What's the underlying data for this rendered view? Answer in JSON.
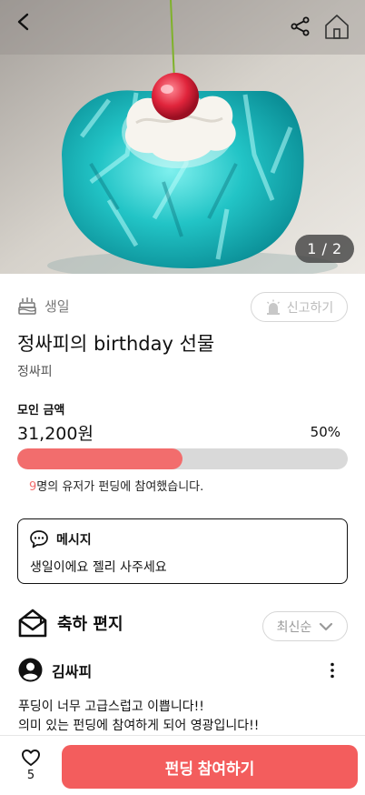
{
  "hero": {
    "page_indicator": "1 / 2",
    "icons": {
      "back": "back-arrow-icon",
      "share": "share-icon",
      "home": "home-icon"
    }
  },
  "category": {
    "icon": "birthday-cake-icon",
    "label": "생일"
  },
  "report_button": {
    "icon": "siren-icon",
    "label": "신고하기"
  },
  "title": "정싸피의 birthday 선물",
  "author": "정싸피",
  "funding": {
    "label": "모인 금액",
    "amount": "31,200원",
    "percent_text": "50%",
    "progress": 0.5,
    "participant_count": "9",
    "participant_suffix": "명의 유저가 펀딩에 참여했습니다."
  },
  "message": {
    "icon": "speech-bubble-icon",
    "title": "메시지",
    "body": "생일이에요 젤리 사주세요"
  },
  "letters": {
    "icon": "mail-envelope-icon",
    "title": "축하 편지",
    "sort_label": "최신순",
    "comment": {
      "author": "김싸피",
      "lines": [
        "푸딩이 너무 고급스럽고 이쁩니다!!",
        "의미 있는 펀딩에 참여하게 되어 영광입니다!!"
      ]
    }
  },
  "bottom": {
    "like_count": "5",
    "cta_label": "펀딩 참여하기"
  },
  "colors": {
    "accent": "#f35d5d",
    "progress_fill": "#f26d6d",
    "progress_track": "#d9d9d9"
  }
}
